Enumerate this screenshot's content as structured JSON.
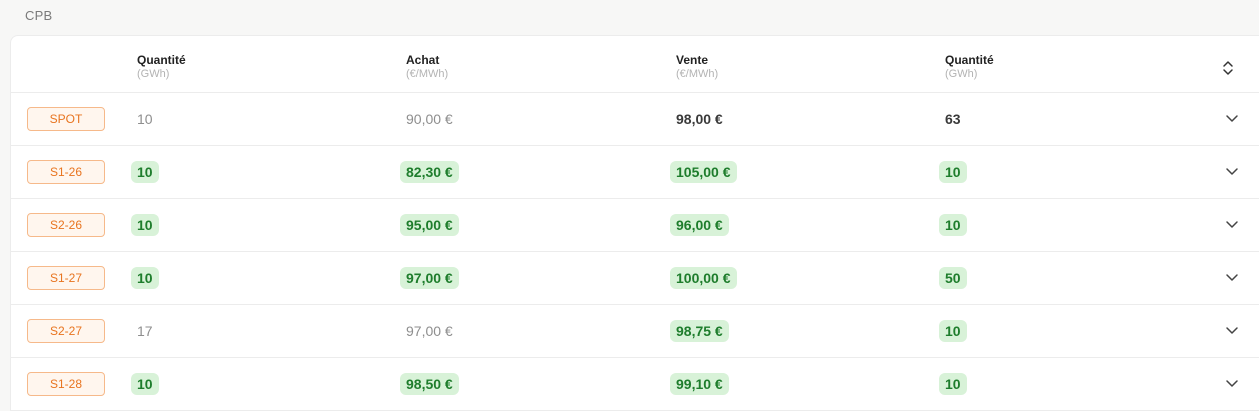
{
  "section": {
    "title": "CPB"
  },
  "headers": [
    {
      "label": "Quantité",
      "unit": "(GWh)"
    },
    {
      "label": "Achat",
      "unit": "(€/MWh)"
    },
    {
      "label": "Vente",
      "unit": "(€/MWh)"
    },
    {
      "label": "Quantité",
      "unit": "(GWh)"
    }
  ],
  "icons": {
    "sort": "sort-icon",
    "expand": "chevron-down-icon"
  },
  "colors": {
    "badge_border": "#f6b98a",
    "badge_text": "#e8741f",
    "pill_bg": "#d8f2d8",
    "pill_text": "#1e7d2c"
  },
  "rows": [
    {
      "period": "SPOT",
      "cells": [
        {
          "value": "10",
          "style": "plain"
        },
        {
          "value": "90,00 €",
          "style": "plain"
        },
        {
          "value": "98,00 €",
          "style": "bold"
        },
        {
          "value": "63",
          "style": "bold"
        }
      ]
    },
    {
      "period": "S1-26",
      "cells": [
        {
          "value": "10",
          "style": "pill"
        },
        {
          "value": "82,30 €",
          "style": "pill"
        },
        {
          "value": "105,00 €",
          "style": "pill"
        },
        {
          "value": "10",
          "style": "pill"
        }
      ]
    },
    {
      "period": "S2-26",
      "cells": [
        {
          "value": "10",
          "style": "pill"
        },
        {
          "value": "95,00 €",
          "style": "pill"
        },
        {
          "value": "96,00 €",
          "style": "pill"
        },
        {
          "value": "10",
          "style": "pill"
        }
      ]
    },
    {
      "period": "S1-27",
      "cells": [
        {
          "value": "10",
          "style": "pill"
        },
        {
          "value": "97,00 €",
          "style": "pill"
        },
        {
          "value": "100,00 €",
          "style": "pill"
        },
        {
          "value": "50",
          "style": "pill"
        }
      ]
    },
    {
      "period": "S2-27",
      "cells": [
        {
          "value": "17",
          "style": "plain"
        },
        {
          "value": "97,00 €",
          "style": "plain"
        },
        {
          "value": "98,75 €",
          "style": "pill"
        },
        {
          "value": "10",
          "style": "pill"
        }
      ]
    },
    {
      "period": "S1-28",
      "cells": [
        {
          "value": "10",
          "style": "pill"
        },
        {
          "value": "98,50 €",
          "style": "pill"
        },
        {
          "value": "99,10 €",
          "style": "pill"
        },
        {
          "value": "10",
          "style": "pill"
        }
      ]
    }
  ]
}
